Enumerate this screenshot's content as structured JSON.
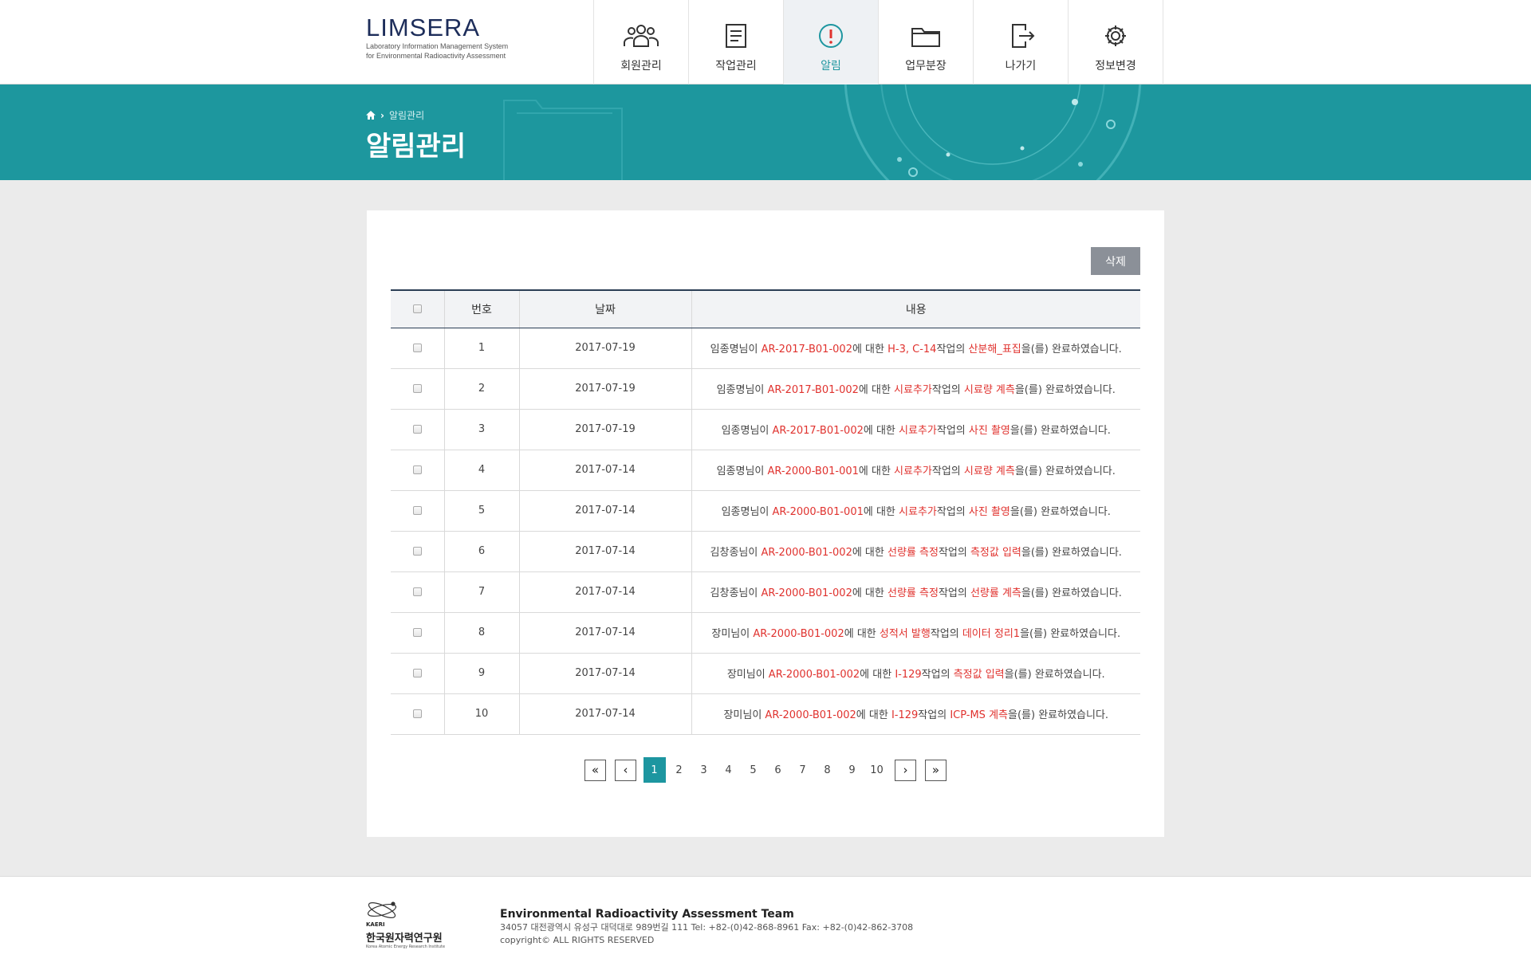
{
  "header": {
    "logo_title": "LIMSERA",
    "logo_sub1": "Laboratory Information Management System",
    "logo_sub2": "for Environmental Radioactivity Assessment",
    "nav": [
      {
        "label": "회원관리",
        "icon": "users-icon"
      },
      {
        "label": "작업관리",
        "icon": "document-icon"
      },
      {
        "label": "알림",
        "icon": "alert-icon",
        "active": true
      },
      {
        "label": "업무분장",
        "icon": "folder-icon"
      },
      {
        "label": "나가기",
        "icon": "logout-icon"
      },
      {
        "label": "정보변경",
        "icon": "gear-icon"
      }
    ]
  },
  "banner": {
    "breadcrumb": "알림관리",
    "title": "알림관리"
  },
  "toolbar": {
    "delete_label": "삭제"
  },
  "table": {
    "headers": {
      "number": "번호",
      "date": "날짜",
      "content": "내용"
    },
    "rows": [
      {
        "no": "1",
        "date": "2017-07-19",
        "parts": [
          [
            "임종명님이 ",
            0
          ],
          [
            "AR-2017-B01-002",
            1
          ],
          [
            "에 대한 ",
            0
          ],
          [
            "H-3, C-14",
            1
          ],
          [
            "작업의 ",
            0
          ],
          [
            "산분해_표집",
            1
          ],
          [
            "을(를) 완료하였습니다.",
            0
          ]
        ]
      },
      {
        "no": "2",
        "date": "2017-07-19",
        "parts": [
          [
            "임종명님이 ",
            0
          ],
          [
            "AR-2017-B01-002",
            1
          ],
          [
            "에 대한 ",
            0
          ],
          [
            "시료추가",
            1
          ],
          [
            "작업의 ",
            0
          ],
          [
            "시료량 계측",
            1
          ],
          [
            "을(를) 완료하였습니다.",
            0
          ]
        ]
      },
      {
        "no": "3",
        "date": "2017-07-19",
        "parts": [
          [
            "임종명님이 ",
            0
          ],
          [
            "AR-2017-B01-002",
            1
          ],
          [
            "에 대한 ",
            0
          ],
          [
            "시료추가",
            1
          ],
          [
            "작업의 ",
            0
          ],
          [
            "사진 촬영",
            1
          ],
          [
            "을(를) 완료하였습니다.",
            0
          ]
        ]
      },
      {
        "no": "4",
        "date": "2017-07-14",
        "parts": [
          [
            "임종명님이 ",
            0
          ],
          [
            "AR-2000-B01-001",
            1
          ],
          [
            "에 대한 ",
            0
          ],
          [
            "시료추가",
            1
          ],
          [
            "작업의 ",
            0
          ],
          [
            "시료량 계측",
            1
          ],
          [
            "을(를) 완료하였습니다.",
            0
          ]
        ]
      },
      {
        "no": "5",
        "date": "2017-07-14",
        "parts": [
          [
            "임종명님이 ",
            0
          ],
          [
            "AR-2000-B01-001",
            1
          ],
          [
            "에 대한 ",
            0
          ],
          [
            "시료추가",
            1
          ],
          [
            "작업의 ",
            0
          ],
          [
            "사진 촬영",
            1
          ],
          [
            "을(를) 완료하였습니다.",
            0
          ]
        ]
      },
      {
        "no": "6",
        "date": "2017-07-14",
        "parts": [
          [
            "김창종님이 ",
            0
          ],
          [
            "AR-2000-B01-002",
            1
          ],
          [
            "에 대한 ",
            0
          ],
          [
            "선량률 측정",
            1
          ],
          [
            "작업의 ",
            0
          ],
          [
            "측정값 입력",
            1
          ],
          [
            "을(를) 완료하였습니다.",
            0
          ]
        ]
      },
      {
        "no": "7",
        "date": "2017-07-14",
        "parts": [
          [
            "김창종님이 ",
            0
          ],
          [
            "AR-2000-B01-002",
            1
          ],
          [
            "에 대한 ",
            0
          ],
          [
            "선량률 측정",
            1
          ],
          [
            "작업의 ",
            0
          ],
          [
            "선량률 계측",
            1
          ],
          [
            "을(를) 완료하였습니다.",
            0
          ]
        ]
      },
      {
        "no": "8",
        "date": "2017-07-14",
        "parts": [
          [
            "장미님이 ",
            0
          ],
          [
            "AR-2000-B01-002",
            1
          ],
          [
            "에 대한 ",
            0
          ],
          [
            "성적서 발행",
            1
          ],
          [
            "작업의 ",
            0
          ],
          [
            "데이터 정리1",
            1
          ],
          [
            "을(를) 완료하였습니다.",
            0
          ]
        ]
      },
      {
        "no": "9",
        "date": "2017-07-14",
        "parts": [
          [
            "장미님이 ",
            0
          ],
          [
            "AR-2000-B01-002",
            1
          ],
          [
            "에 대한 ",
            0
          ],
          [
            "I-129",
            1
          ],
          [
            "작업의 ",
            0
          ],
          [
            "측정값 입력",
            1
          ],
          [
            "을(를) 완료하였습니다.",
            0
          ]
        ]
      },
      {
        "no": "10",
        "date": "2017-07-14",
        "parts": [
          [
            "장미님이 ",
            0
          ],
          [
            "AR-2000-B01-002",
            1
          ],
          [
            "에 대한 ",
            0
          ],
          [
            "I-129",
            1
          ],
          [
            "작업의 ",
            0
          ],
          [
            "ICP-MS 계측",
            1
          ],
          [
            "을(를) 완료하였습니다.",
            0
          ]
        ]
      }
    ]
  },
  "pagination": {
    "first": "«",
    "prev": "‹",
    "next": "›",
    "last": "»",
    "pages": [
      "1",
      "2",
      "3",
      "4",
      "5",
      "6",
      "7",
      "8",
      "9",
      "10"
    ],
    "current": "1"
  },
  "footer": {
    "logo_abbr": "KAERI",
    "logo_name": "한국원자력연구원",
    "logo_en": "Korea Atomic Energy Research Institute",
    "team": "Environmental Radioactivity Assessment Team",
    "address": "34057 대전광역시 유성구 대덕대로 989번길 111 Tel: +82-(0)42-868-8961 Fax: +82-(0)42-862-3708",
    "copyright": "copyright© ALL RIGHTS RESERVED"
  },
  "colors": {
    "accent": "#1d96a0",
    "banner": "#1d979e",
    "highlight": "#e0322e",
    "delete_button": "#8b9098"
  }
}
